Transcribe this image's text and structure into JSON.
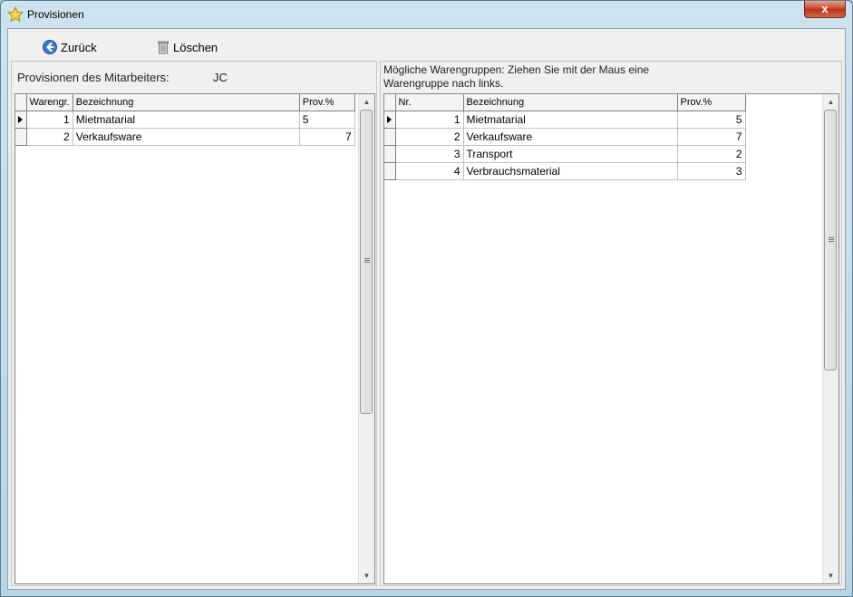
{
  "window": {
    "title": "Provisionen",
    "close_label": "x"
  },
  "toolbar": {
    "back_label": "Zurück",
    "delete_label": "Löschen"
  },
  "left": {
    "label": "Provisionen des Mitarbeiters:",
    "employee": "JC",
    "columns": [
      "Warengr.",
      "Bezeichnung",
      "Prov.%"
    ],
    "rows": [
      {
        "group": "1",
        "name": "Mietmatarial",
        "prov": "5"
      },
      {
        "group": "2",
        "name": "Verkaufsware",
        "prov": "7"
      }
    ]
  },
  "right": {
    "hint": "Mögliche Warengruppen: Ziehen Sie mit der Maus eine Warengruppe nach links.",
    "columns": [
      "Nr.",
      "Bezeichnung",
      "Prov.%"
    ],
    "rows": [
      {
        "nr": "1",
        "name": "Mietmatarial",
        "prov": "5"
      },
      {
        "nr": "2",
        "name": "Verkaufsware",
        "prov": "7"
      },
      {
        "nr": "3",
        "name": "Transport",
        "prov": "2"
      },
      {
        "nr": "4",
        "name": "Verbrauchsmaterial",
        "prov": "3"
      }
    ]
  },
  "icons": {
    "title": "star-icon",
    "back": "back-arrow-icon",
    "delete": "trash-icon"
  }
}
